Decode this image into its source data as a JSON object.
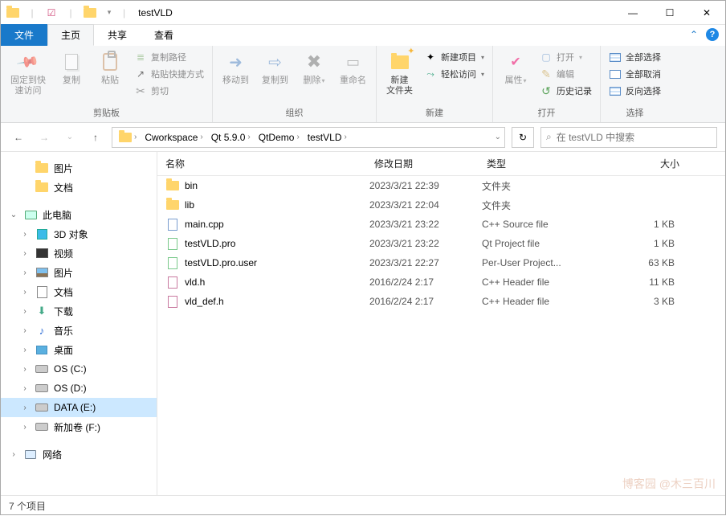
{
  "title": "testVLD",
  "tabs": {
    "file": "文件",
    "home": "主页",
    "share": "共享",
    "view": "查看"
  },
  "ribbon": {
    "clipboard": {
      "label": "剪贴板",
      "pin": "固定到快\n速访问",
      "copy": "复制",
      "paste": "粘贴",
      "copypath": "复制路径",
      "pasteshortcut": "粘贴快捷方式",
      "cut": "剪切"
    },
    "organize": {
      "label": "组织",
      "moveto": "移动到",
      "copyto": "复制到",
      "delete": "删除",
      "rename": "重命名"
    },
    "new_g": {
      "label": "新建",
      "newfolder": "新建\n文件夹",
      "newitem": "新建项目",
      "easyaccess": "轻松访问"
    },
    "open_g": {
      "label": "打开",
      "properties": "属性",
      "open": "打开",
      "edit": "编辑",
      "history": "历史记录"
    },
    "select_g": {
      "label": "选择",
      "all": "全部选择",
      "none": "全部取消",
      "invert": "反向选择"
    }
  },
  "breadcrumb": [
    "Cworkspace",
    "Qt 5.9.0",
    "QtDemo",
    "testVLD"
  ],
  "search_placeholder": "在 testVLD 中搜索",
  "nav": {
    "quick": {
      "pictures": "图片",
      "docs": "文档"
    },
    "thispc": "此电脑",
    "pc": {
      "threeD": "3D 对象",
      "video": "视频",
      "pictures": "图片",
      "docs": "文档",
      "downloads": "下载",
      "music": "音乐",
      "desktop": "桌面",
      "osc": "OS (C:)",
      "osd": "OS (D:)",
      "data": "DATA (E:)",
      "newf": "新加卷 (F:)"
    },
    "network": "网络"
  },
  "columns": {
    "name": "名称",
    "date": "修改日期",
    "type": "类型",
    "size": "大小"
  },
  "files": [
    {
      "icon": "folder",
      "name": "bin",
      "date": "2023/3/21 22:39",
      "type": "文件夹",
      "size": ""
    },
    {
      "icon": "folder",
      "name": "lib",
      "date": "2023/3/21 22:04",
      "type": "文件夹",
      "size": ""
    },
    {
      "icon": "cpp",
      "name": "main.cpp",
      "date": "2023/3/21 23:22",
      "type": "C++ Source file",
      "size": "1 KB"
    },
    {
      "icon": "qt",
      "name": "testVLD.pro",
      "date": "2023/3/21 23:22",
      "type": "Qt Project file",
      "size": "1 KB"
    },
    {
      "icon": "qt",
      "name": "testVLD.pro.user",
      "date": "2023/3/21 22:27",
      "type": "Per-User Project...",
      "size": "63 KB"
    },
    {
      "icon": "h",
      "name": "vld.h",
      "date": "2016/2/24 2:17",
      "type": "C++ Header file",
      "size": "11 KB"
    },
    {
      "icon": "h",
      "name": "vld_def.h",
      "date": "2016/2/24 2:17",
      "type": "C++ Header file",
      "size": "3 KB"
    }
  ],
  "status": "7 个项目",
  "watermark": "博客园 @木三百川"
}
